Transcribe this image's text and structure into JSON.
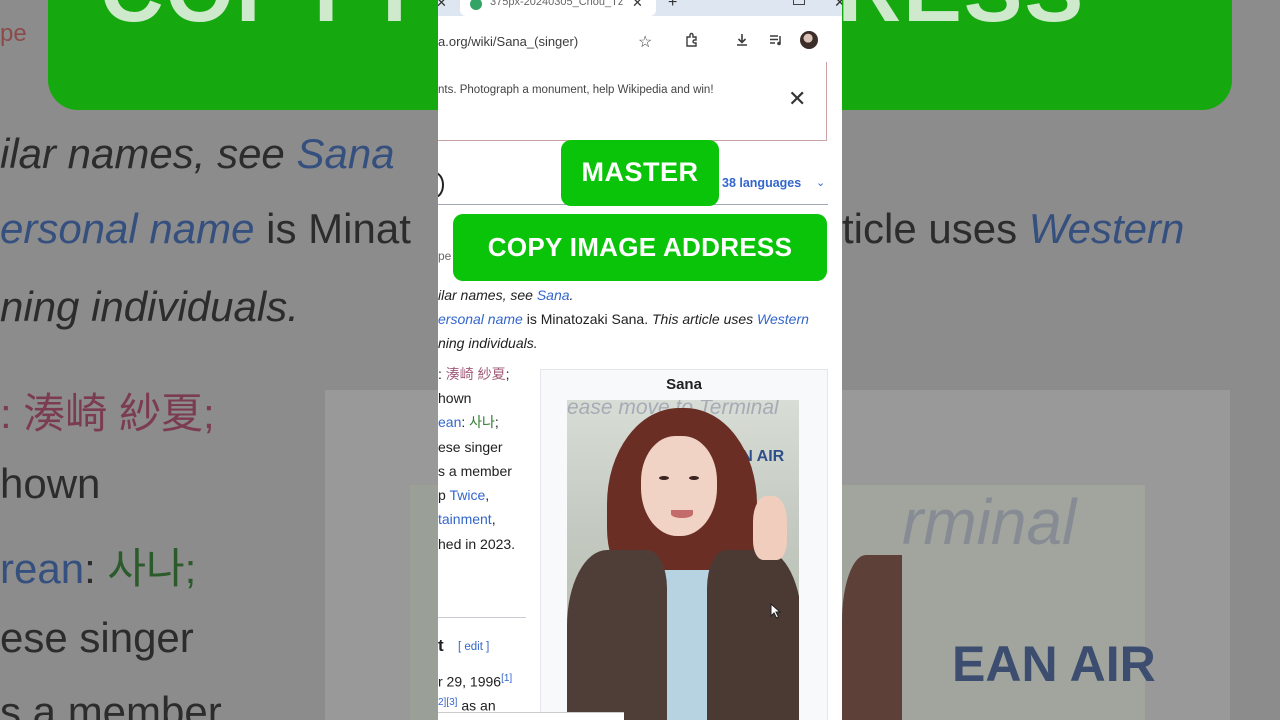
{
  "overlay": {
    "top_label": "MASTER",
    "main_label": "COPY IMAGE ADDRESS"
  },
  "browser": {
    "tab_title": "375px-20240305_Chou_Tz",
    "url": "a.org/wiki/Sana_(singer)"
  },
  "banner": {
    "text": "nts. Photograph a monument, help Wikipedia and win!"
  },
  "article": {
    "languages": "38 languages",
    "hatnote_line1_prefix": "ilar names, see ",
    "hatnote_line1_link": "Sana",
    "hatnote_line1_suffix": ".",
    "hatnote_line2_link": "ersonal name",
    "hatnote_line2_middle": " is Minatozaki Sana. ",
    "hatnote_line2_ital": "This article uses ",
    "hatnote_line2_link2": "Western",
    "hatnote_line3": "ning individuals.",
    "body": [
      {
        "pre": ": ",
        "jp": "湊崎 紗夏",
        "post": ";"
      },
      {
        "text": "hown"
      },
      {
        "link": "ean",
        "mid": ": ",
        "ko": "사나",
        "post": ";"
      },
      {
        "text": "ese singer"
      },
      {
        "text": "s a member"
      },
      {
        "pre": "p ",
        "link": "Twice",
        "post": ","
      },
      {
        "link": "tainment",
        "post": ","
      },
      {
        "text": "hed in 2023."
      }
    ],
    "section_title": "t",
    "section_edit": "[ edit ]",
    "bottom_line1": "r 29, 1996",
    "bottom_ref1": "[1]",
    "bottom_line2_refs": "2][3]",
    "bottom_line2": " as an"
  },
  "infobox": {
    "title": "Sana",
    "photo_sign": "ease move to Terminal",
    "photo_airline": "EAN AIR"
  },
  "background": {
    "green_text_left": "COPY I",
    "green_text_right": "DRESS",
    "line1": "ilar names, see ",
    "line1_link": "Sana",
    "line2_link": "ersonal name",
    "line2_mid": " is Minat",
    "line2_right_prefix": "ticle uses ",
    "line2_right_link": "Western",
    "line3": "ning individuals.",
    "jp": "湊崎 紗夏;",
    "hown": "hown",
    "rean": "rean",
    "ko": "사나;",
    "ese_singer": "ese singer",
    "member": "s a member",
    "photo_text": "rminal",
    "photo_airline": "EAN AIR",
    "small_edge": "pe"
  },
  "colors": {
    "green": "#0ac40a",
    "link": "#3366cc"
  }
}
